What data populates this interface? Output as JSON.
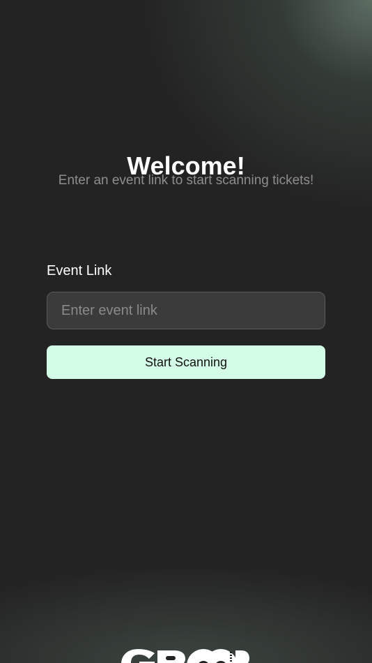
{
  "welcome": {
    "title": "Welcome!",
    "subtitle": "Enter an event link to start scanning tickets!"
  },
  "form": {
    "event_link_label": "Event Link",
    "event_link_placeholder": "Enter event link",
    "event_link_value": "",
    "start_button_label": "Start Scanning"
  },
  "brand": {
    "logo_icon": "brand-logo-icon",
    "logo_text": "GBOOB",
    "logo_small_text": "TICKETS"
  },
  "colors": {
    "background": "#232323",
    "accent_button": "#d3fde6",
    "input_background": "#3b3b3b",
    "subtitle_text": "#8e8e8e"
  }
}
